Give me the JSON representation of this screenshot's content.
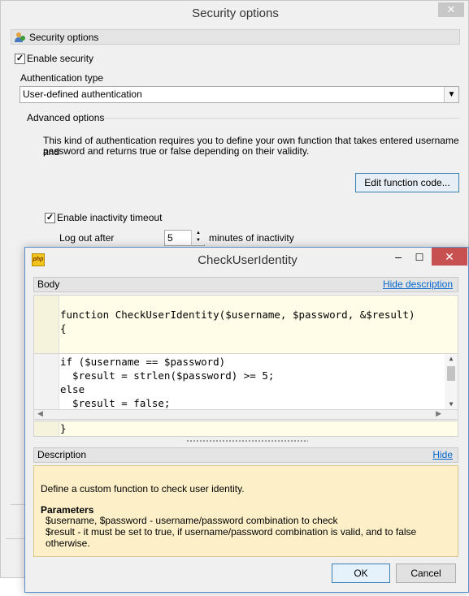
{
  "background_window": {
    "title": "Security options",
    "close_glyph": "✕",
    "section_header": "Security options",
    "enable_security": {
      "label": "Enable security",
      "checked": true
    },
    "auth_type_label": "Authentication type",
    "auth_type_value": "User-defined authentication",
    "advanced_label": "Advanced options",
    "description_line1": "This kind of authentication requires you to define your own function that takes entered username and",
    "description_line2": "password and returns true or false depending on their validity.",
    "edit_button": "Edit function code...",
    "enable_timeout": {
      "label": "Enable inactivity timeout",
      "checked": true
    },
    "logout_label": "Log out after",
    "timeout_value": "5",
    "timeout_unit": "minutes of inactivity"
  },
  "dialog": {
    "title": "CheckUserIdentity",
    "icon_text": "php",
    "body_label": "Body",
    "hide_description_link": "Hide description",
    "code_signature": "function CheckUserIdentity($username, $password, &$result)",
    "code_open_brace": "{",
    "code_lines": [
      "if ($username == $password)",
      "  $result = strlen($password) >= 5;",
      "else",
      "  $result = false;"
    ],
    "code_close_brace": "}",
    "description_label": "Description",
    "hide_link": "Hide",
    "description_text": "Define a custom function to check user identity.",
    "parameters_heading": "Parameters",
    "param_1": "$username, $password - username/password combination to check",
    "param_2": "$result - it must be set to true, if username/password combination is valid, and to false otherwise.",
    "ok_button": "OK",
    "cancel_button": "Cancel"
  },
  "colors": {
    "accent": "#3c7fb1",
    "link": "#0066cc",
    "close_red": "#c75050",
    "code_bg": "#fffde7",
    "description_bg": "#fdf0c8"
  }
}
